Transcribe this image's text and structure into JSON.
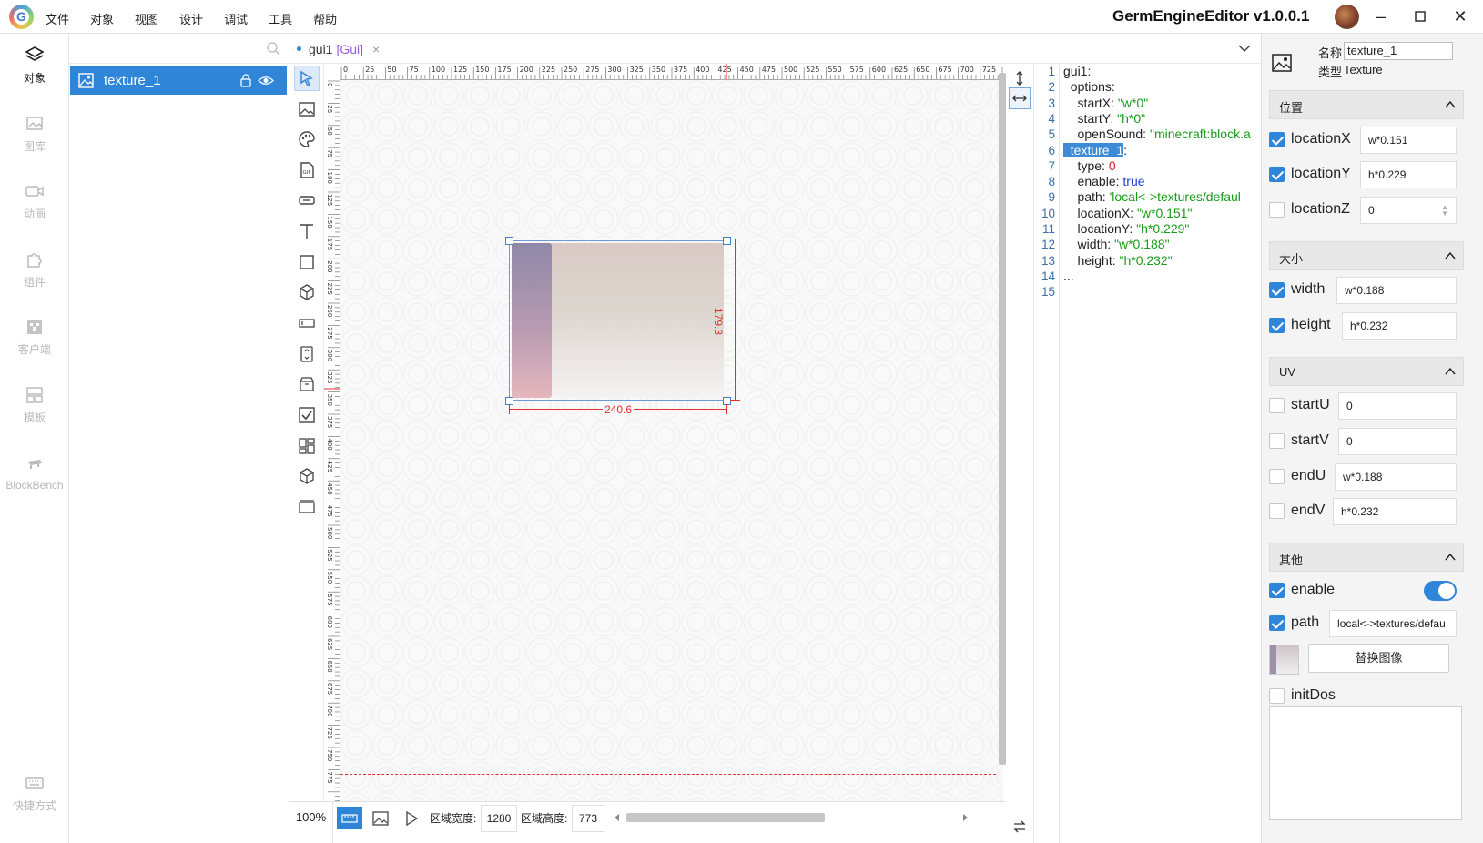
{
  "app": {
    "logo_letter": "G",
    "title": "GermEngineEditor v1.0.0.1",
    "menu": [
      "文件",
      "对象",
      "视图",
      "设计",
      "调试",
      "工具",
      "帮助"
    ]
  },
  "sidebar": {
    "items": [
      {
        "label": "对象",
        "icon": "layers-icon"
      },
      {
        "label": "图库",
        "icon": "image-gallery-icon"
      },
      {
        "label": "动画",
        "icon": "video-camera-icon"
      },
      {
        "label": "组件",
        "icon": "puzzle-icon"
      },
      {
        "label": "客户端",
        "icon": "client-icon"
      },
      {
        "label": "模板",
        "icon": "template-icon"
      },
      {
        "label": "BlockBench",
        "icon": "blockbench-icon"
      },
      {
        "label": "快捷方式",
        "icon": "keyboard-icon"
      }
    ]
  },
  "objects": {
    "search_placeholder": "",
    "items": [
      {
        "name": "texture_1"
      }
    ]
  },
  "editor": {
    "tab": {
      "name": "gui1",
      "type": "[Gui]",
      "close": "×"
    }
  },
  "rulers": {
    "top": [
      "0",
      "25",
      "50",
      "75",
      "100",
      "125",
      "150",
      "175",
      "200",
      "225",
      "250",
      "275",
      "300",
      "325",
      "350",
      "375",
      "400",
      "425",
      "450",
      "475",
      "500",
      "525",
      "550",
      "575",
      "600",
      "625",
      "650",
      "675",
      "700",
      "725"
    ],
    "left": [
      "0",
      "25",
      "50",
      "75",
      "100",
      "125",
      "150",
      "175",
      "200",
      "225",
      "250",
      "275",
      "300",
      "325",
      "350",
      "375",
      "400",
      "425",
      "450",
      "475",
      "500",
      "525",
      "550",
      "575",
      "600",
      "625",
      "650",
      "675",
      "700",
      "725",
      "750",
      "775"
    ]
  },
  "canvas": {
    "dim_width": "240.6",
    "dim_height": "179.3"
  },
  "bottom": {
    "zoom": "100%",
    "area_width_label": "区域宽度:",
    "area_width": "1280",
    "area_height_label": "区域高度:",
    "area_height": "773"
  },
  "code": {
    "line_numbers": [
      "1",
      "2",
      "3",
      "4",
      "5",
      "6",
      "7",
      "8",
      "9",
      "10",
      "11",
      "12",
      "13",
      "14",
      "15"
    ],
    "lines": [
      {
        "key": "gui1:",
        "val": "",
        "cls": ""
      },
      {
        "key": "  options:",
        "val": "",
        "cls": ""
      },
      {
        "key": "    startX: ",
        "val": "\"w*0\"",
        "cls": "str"
      },
      {
        "key": "    startY: ",
        "val": "\"h*0\"",
        "cls": "str"
      },
      {
        "key": "    openSound: ",
        "val": "\"minecraft:block.a",
        "cls": "str"
      },
      {
        "key": "",
        "val": "",
        "cls": ""
      },
      {
        "key": "    type: ",
        "val": "0",
        "cls": "num"
      },
      {
        "key": "    enable: ",
        "val": "true",
        "cls": "kw"
      },
      {
        "key": "    path: ",
        "val": "'local<->textures/defaul",
        "cls": "str"
      },
      {
        "key": "    locationX: ",
        "val": "\"w*0.151\"",
        "cls": "str"
      },
      {
        "key": "    locationY: ",
        "val": "\"h*0.229\"",
        "cls": "str"
      },
      {
        "key": "    width: ",
        "val": "\"w*0.188\"",
        "cls": "str"
      },
      {
        "key": "    height: ",
        "val": "\"h*0.232\"",
        "cls": "str"
      },
      {
        "key": "...",
        "val": "",
        "cls": ""
      },
      {
        "key": "",
        "val": "",
        "cls": ""
      }
    ],
    "highlight_key": "texture_1",
    "highlight_suffix": ":"
  },
  "props": {
    "name_label": "名称",
    "name_value": "texture_1",
    "type_label": "类型",
    "type_value": "Texture",
    "sections": {
      "position": "位置",
      "size": "大小",
      "uv": "UV",
      "other": "其他"
    },
    "position": [
      {
        "label": "locationX",
        "value": "w*0.151",
        "checked": true
      },
      {
        "label": "locationY",
        "value": "h*0.229",
        "checked": true
      },
      {
        "label": "locationZ",
        "value": "0",
        "checked": false
      }
    ],
    "size": [
      {
        "label": "width",
        "value": "w*0.188",
        "checked": true
      },
      {
        "label": "height",
        "value": "h*0.232",
        "checked": true
      }
    ],
    "uv": [
      {
        "label": "startU",
        "value": "0",
        "checked": false
      },
      {
        "label": "startV",
        "value": "0",
        "checked": false
      },
      {
        "label": "endU",
        "value": "w*0.188",
        "checked": false
      },
      {
        "label": "endV",
        "value": "h*0.232",
        "checked": false
      }
    ],
    "other": {
      "enable_label": "enable",
      "path_label": "path",
      "path_value": "local<->textures/defau",
      "replace_button": "替换图像",
      "initdos_label": "initDos"
    }
  },
  "colors": {
    "accent": "#2f86d9",
    "dimension": "#e03030"
  }
}
